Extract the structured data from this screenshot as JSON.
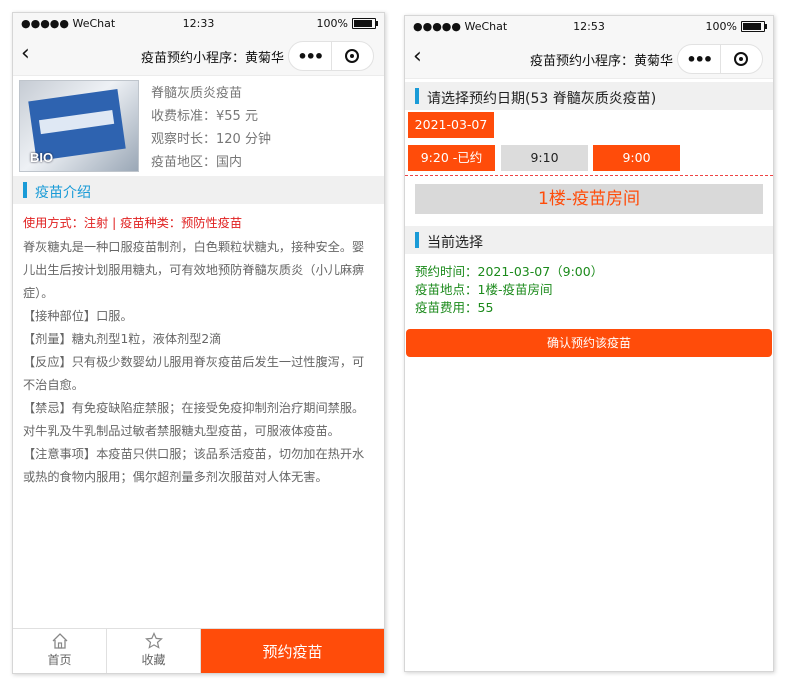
{
  "status_bar": {
    "carrier": "●●●●● WeChat",
    "battery": "100%",
    "battery_level": 1.0
  },
  "detail": {
    "status_bar": {
      "time": "12:33"
    },
    "nav": {
      "back_icon": "chevron-left-icon",
      "title": "疫苗预约小程序：黄菊华",
      "more_icon": "more-dots-icon",
      "close_icon": "target-close-icon"
    },
    "product": {
      "image_text": "BIO",
      "name": "脊髓灰质炎疫苗",
      "price": "收费标准：¥55 元",
      "duration": "观察时长：120 分钟",
      "region": "疫苗地区：国内"
    },
    "section_title": "疫苗介绍",
    "usage_line": "使用方式：注射 | 疫苗种类：预防性疫苗",
    "paragraphs": [
      "脊灰糖丸是一种口服疫苗制剂，白色颗粒状糖丸，接种安全。婴儿出生后按计划服用糖丸，可有效地预防脊髓灰质炎（小儿麻痹症）。",
      "【接种部位】口服。",
      "【剂量】糖丸剂型1粒，液体剂型2滴",
      "【反应】只有极少数婴幼儿服用脊灰疫苗后发生一过性腹泻，可不治自愈。",
      "【禁忌】有免疫缺陷症禁服；在接受免疫抑制剂治疗期间禁服。对牛乳及牛乳制品过敏者禁服糖丸型疫苗，可服液体疫苗。",
      "【注意事项】本疫苗只供口服；该品系活疫苗，切勿加在热开水或热的食物内服用；偶尔超剂量多剂次服苗对人体无害。"
    ],
    "tabbar": {
      "home": {
        "label": "首页",
        "icon": "home-icon"
      },
      "favorite": {
        "label": "收藏",
        "icon": "star-icon"
      },
      "book": "预约疫苗"
    }
  },
  "booking": {
    "status_bar": {
      "time": "12:53"
    },
    "nav": {
      "title": "疫苗预约小程序：黄菊华"
    },
    "date_section_title": "请选择预约日期(53 脊髓灰质炎疫苗)",
    "selected_date": "2021-03-07",
    "time_slots": [
      {
        "label": "9:20 -已约",
        "state": "booked"
      },
      {
        "label": "9:10",
        "state": "available"
      },
      {
        "label": "9:00",
        "state": "selected"
      }
    ],
    "room": "1楼-疫苗房间",
    "current_section_title": "当前选择",
    "current": {
      "time": "预约时间：2021-03-07（9:00）",
      "place": "疫苗地点：1楼-疫苗房间",
      "fee": "疫苗费用：55"
    },
    "confirm_button": "确认预约该疫苗"
  },
  "colors": {
    "accent": "#ff4c0a",
    "section_bar": "#1a9bd7",
    "usage_text": "#e02020",
    "selection_text": "#1b8a1b"
  }
}
